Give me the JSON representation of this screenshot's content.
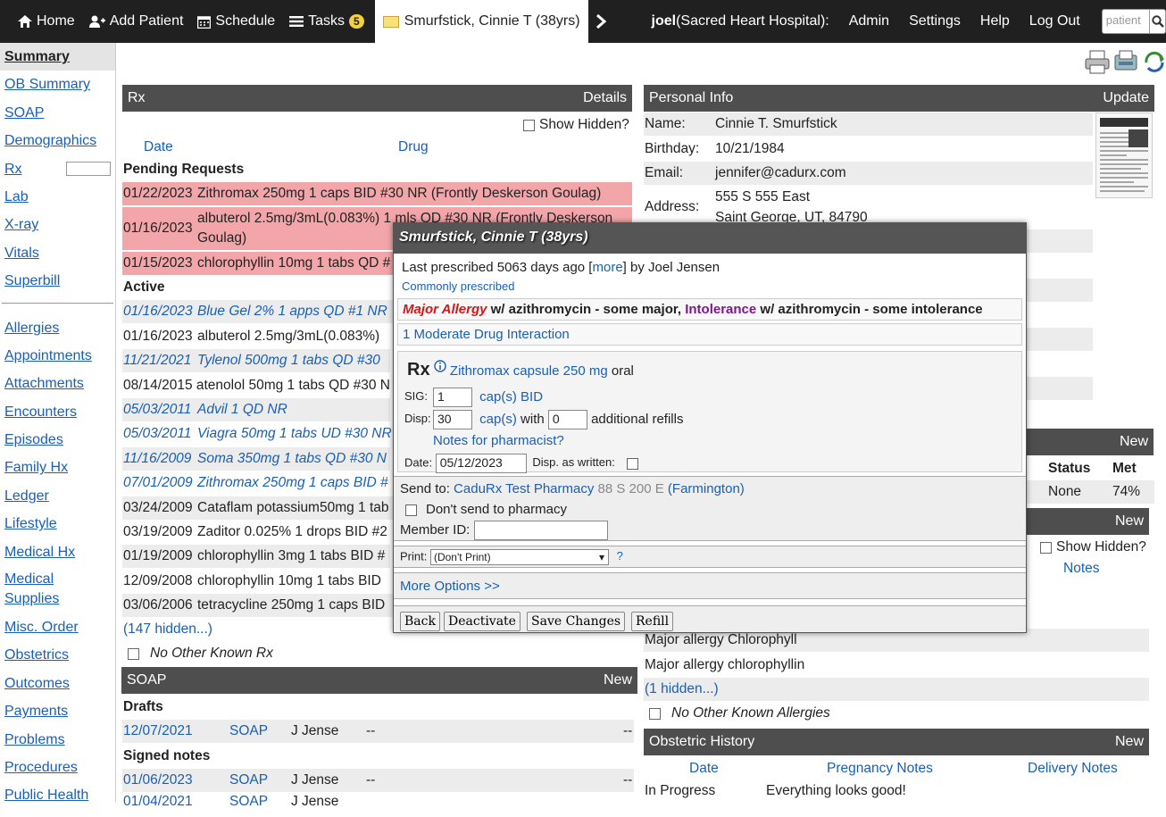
{
  "nav": {
    "home": "Home",
    "add_patient": "Add Patient",
    "schedule": "Schedule",
    "tasks": "Tasks",
    "tasks_count": "5",
    "patient_tab": "Smurfstick, Cinnie T (38yrs)",
    "user": "joel",
    "hospital": "(Sacred Heart Hospital):",
    "admin": "Admin",
    "settings": "Settings",
    "help": "Help",
    "logout": "Log Out",
    "search_placeholder": "patient"
  },
  "sidebar": {
    "items": [
      "Summary",
      "OB Summary",
      "SOAP",
      "Demographics",
      "Rx",
      "Lab",
      "X-ray",
      "Vitals",
      "Superbill"
    ],
    "items2": [
      "Allergies",
      "Appointments",
      "Attachments",
      "Encounters",
      "Episodes",
      "Family Hx",
      "Ledger",
      "Lifestyle",
      "Medical Hx",
      "Medical Supplies",
      "Misc. Order",
      "Obstetrics",
      "Outcomes",
      "Payments",
      "Problems",
      "Procedures",
      "Public Health"
    ]
  },
  "rx": {
    "title": "Rx",
    "details": "Details",
    "show_hidden": "Show Hidden?",
    "col_date": "Date",
    "col_drug": "Drug",
    "pending_label": "Pending Requests",
    "active_label": "Active",
    "pending": [
      {
        "date": "01/22/2023",
        "drug": "Zithromax 250mg 1 caps BID #30 NR (Frontly Deskerson Goulag)"
      },
      {
        "date": "01/16/2023",
        "drug": "albuterol 2.5mg/3mL(0.083%) 1 mls QD #30 NR (Frontly Deskerson Goulag)"
      },
      {
        "date": "01/15/2023",
        "drug": "chlorophyllin 10mg 1 tabs QD #"
      }
    ],
    "active": [
      {
        "date": "01/16/2023",
        "drug": "Blue Gel 2% 1 apps QD #1 NR"
      },
      {
        "date": "01/16/2023",
        "drug": "albuterol 2.5mg/3mL(0.083%)"
      },
      {
        "date": "11/21/2021",
        "drug": "Tylenol 500mg 1 tabs QD #30"
      },
      {
        "date": "08/14/2015",
        "drug": "atenolol 50mg 1 tabs QD #30 N"
      },
      {
        "date": "05/03/2011",
        "drug": "Advil 1 QD NR"
      },
      {
        "date": "05/03/2011",
        "drug": "Viagra 50mg 1 tabs UD #30 NR"
      },
      {
        "date": "11/16/2009",
        "drug": "Soma 350mg 1 tabs QD #30 N"
      },
      {
        "date": "07/01/2009",
        "drug": "Zithromax 250mg 1 caps BID #"
      },
      {
        "date": "03/24/2009",
        "drug": "Cataflam potassium50mg 1 tab"
      },
      {
        "date": "03/19/2009",
        "drug": "Zaditor 0.025% 1 drops BID #2"
      },
      {
        "date": "01/19/2009",
        "drug": "chlorophyllin 3mg 1 tabs BID #"
      },
      {
        "date": "12/09/2008",
        "drug": "chlorophyllin 10mg 1 tabs BID"
      },
      {
        "date": "03/06/2006",
        "drug": "tetracycline 250mg 1 caps BID"
      }
    ],
    "hidden": "(147 hidden...)",
    "no_other": "No Other Known Rx"
  },
  "soap": {
    "title": "SOAP",
    "new": "New",
    "drafts": "Drafts",
    "signed": "Signed notes",
    "rows": [
      {
        "date": "12/07/2021",
        "type": "SOAP",
        "by": "J Jense",
        "a": "--",
        "b": "--"
      },
      {
        "date": "01/06/2023",
        "type": "SOAP",
        "by": "J Jense",
        "a": "--",
        "b": "--"
      },
      {
        "date": "01/04/2021",
        "type": "SOAP",
        "by": "J Jense",
        "a": "",
        "b": ""
      }
    ]
  },
  "personal": {
    "title": "Personal Info",
    "update": "Update",
    "name_label": "Name:",
    "name": "Cinnie T. Smurfstick",
    "birthday_label": "Birthday:",
    "birthday": "10/21/1984",
    "email_label": "Email:",
    "email": "jennifer@cadurx.com",
    "address_label": "Address:",
    "address1": "555 S 555 East",
    "address2": "Saint George, UT, 84790"
  },
  "goals": {
    "new": "New",
    "status": "Status",
    "met": "Met",
    "status_val": "None",
    "met_val": "74%"
  },
  "allergies": {
    "new": "New",
    "show_hidden": "Show Hidden?",
    "notes": "Notes",
    "rows": [
      "Major allergy Chlorophyll",
      "Major allergy chlorophyllin"
    ],
    "hidden": "(1 hidden...)",
    "no_other": "No Other Known Allergies"
  },
  "obstetric": {
    "title": "Obstetric History",
    "new": "New",
    "col_date": "Date",
    "col_preg": "Pregnancy Notes",
    "col_deliv": "Delivery Notes",
    "row_date": "In Progress",
    "row_notes": "Everything looks good!"
  },
  "modal": {
    "title": "Smurfstick, Cinnie T (38yrs)",
    "last_prescribed": "Last prescribed 5063 days ago [",
    "more": "more",
    "by": "] by Joel Jensen",
    "commonly": "Commonly prescribed",
    "major_allergy": "Major Allergy",
    "allergy_text": " w/ azithromycin - some major, ",
    "intolerance": "Intolerance",
    "intolerance_text": " w/ azithromycin - some intolerance",
    "interaction": "1 Moderate Drug Interaction",
    "rx_label": "Rx",
    "drug": "Zithromax",
    "form": "capsule",
    "strength": "250 mg",
    "route": "oral",
    "sig_label": "SIG:",
    "sig_val": "1",
    "sig_unit": "cap(s)",
    "sig_freq": "BID",
    "disp_label": "Disp:",
    "disp_val": "30",
    "disp_unit": "cap(s)",
    "with": "with",
    "refills": "0",
    "additional": "additional refills",
    "notes_link": "Notes for pharmacist?",
    "date_label": "Date:",
    "date_val": "05/12/2023",
    "daw_label": "Disp. as written:",
    "send_to": "Send to: ",
    "pharmacy": "CaduRx Test Pharmacy",
    "pharmacy_addr": "88 S 200 E",
    "pharmacy_city": "(Farmington)",
    "dont_send": "Don't send to pharmacy",
    "member_label": "Member ID:",
    "print_label": "Print:",
    "print_val": "(Don't Print)",
    "q": "?",
    "more_options": "More Options >>",
    "btn_back": "Back",
    "btn_deactivate": "Deactivate",
    "btn_save": "Save Changes",
    "btn_refill": "Refill"
  },
  "colors": {
    "nav_bg": "#202020",
    "header_bg": "#4e4e4e",
    "pending": "#f2a6a9",
    "link": "#1a5fb4",
    "allergy_red": "#d01818",
    "intolerance_purple": "#7a1a8a"
  }
}
